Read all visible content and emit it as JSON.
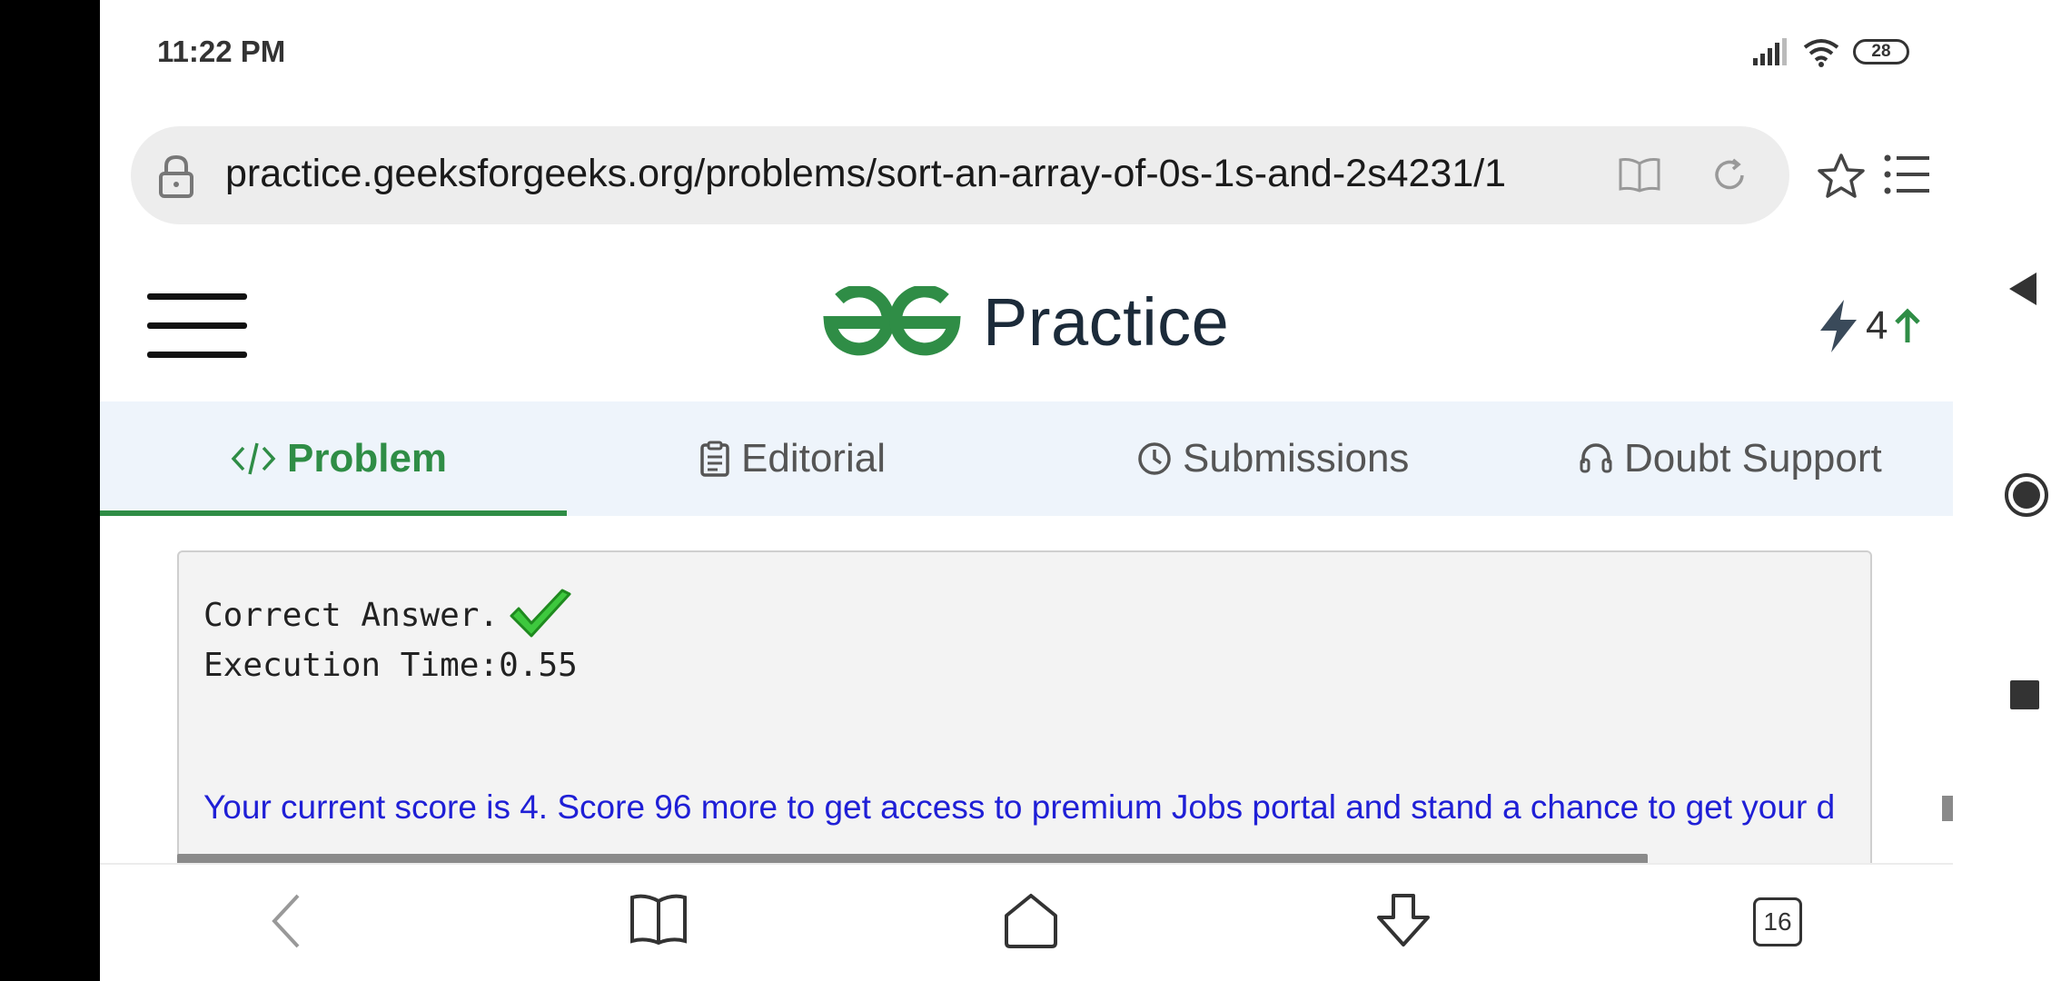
{
  "status_bar": {
    "time": "11:22 PM",
    "battery": "28"
  },
  "browser": {
    "url": "practice.geeksforgeeks.org/problems/sort-an-array-of-0s-1s-and-2s4231/1",
    "tab_count": "16"
  },
  "header": {
    "logo_text": "Practice",
    "streak_count": "4"
  },
  "tabs": [
    {
      "label": "Problem",
      "active": true
    },
    {
      "label": "Editorial",
      "active": false
    },
    {
      "label": "Submissions",
      "active": false
    },
    {
      "label": "Doubt Support",
      "active": false
    }
  ],
  "result": {
    "status": "Correct Answer.",
    "execution_time": "Execution Time:0.55",
    "score_message": "Your current score is 4. Score 96 more to get access to premium Jobs portal and stand a chance to get your d"
  },
  "colors": {
    "brand_green": "#2f8d46",
    "link_blue": "#1f1fd6",
    "tab_bg": "#eef4fb"
  }
}
